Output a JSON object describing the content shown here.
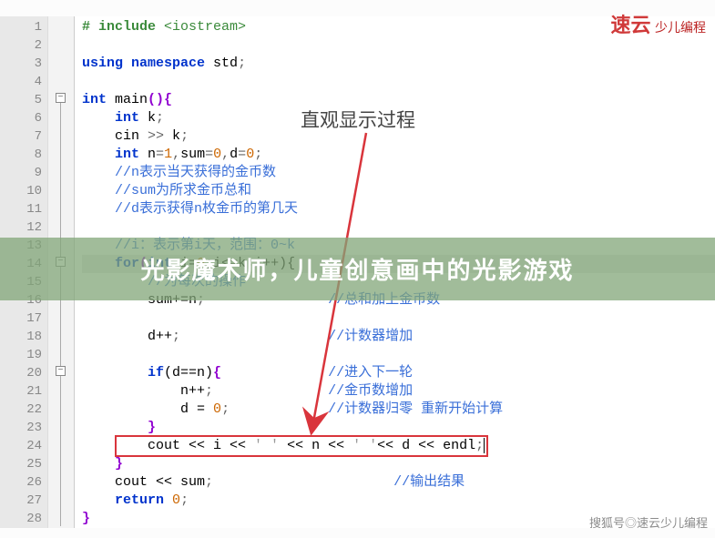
{
  "watermark_top_brand": "速云",
  "watermark_top_sub": "少儿编程",
  "watermark_bottom": "搜狐号◎速云少儿编程",
  "annotation": "直观显示过程",
  "banner": "光影魔术师，儿童创意画中的光影游戏",
  "lines": {
    "l1_pre": "# include ",
    "l1_inc": "<iostream>",
    "l3_using": "using",
    "l3_ns": "namespace",
    "l3_std": " std",
    "l3_semi": ";",
    "l5_int": "int",
    "l5_main": " main",
    "l5_par": "(){",
    "l6_int": "int",
    "l6_k": " k",
    "l6_semi": ";",
    "l7_cin": "cin ",
    "l7_op": ">>",
    "l7_k": " k",
    "l7_semi": ";",
    "l8_int": "int",
    "l8_n": " n",
    "l8_eq1": "=",
    "l8_1": "1",
    "l8_com1": ",",
    "l8_sum": "sum",
    "l8_eq2": "=",
    "l8_0a": "0",
    "l8_com2": ",",
    "l8_d": "d",
    "l8_eq3": "=",
    "l8_0b": "0",
    "l8_semi": ";",
    "l9": "//n表示当天获得的金币数",
    "l10": "//sum为所求金币总和",
    "l11": "//d表示获得n枚金币的第几天",
    "l13": "//i：表示第i天，范围：0~k",
    "l14_for": "for",
    "l14_par_o": "(",
    "l14_int": "int",
    "l14_ie0": " i=",
    "l14_0": "0",
    "l14_semi1": ";i<=k;i++){",
    "l15_c": "//为每次的操作",
    "l16_body": "sum+=n",
    "l16_semi": ";",
    "l16_c": "//总和加上金币数",
    "l18_body": "d++",
    "l18_semi": ";",
    "l18_c": "//计数器增加",
    "l20_if": "if",
    "l20_cond": "(d==n)",
    "l20_brace": "{",
    "l20_c": "//进入下一轮",
    "l21_body": "n++",
    "l21_semi": ";",
    "l21_c": "//金币数增加",
    "l22_body": "d = ",
    "l22_0": "0",
    "l22_semi": ";",
    "l22_c": "//计数器归零 重新开始计算",
    "l23_brace": "}",
    "l24": "cout << i << ",
    "l24_s1": "' '",
    "l24_m": " << n << ",
    "l24_s2": "' '",
    "l24_e": "<< d << endl",
    "l24_semi": ";",
    "l25_brace": "}",
    "l26_body": "cout << sum",
    "l26_semi": ";",
    "l26_c": "//输出结果",
    "l27_ret": "return",
    "l27_sp": " ",
    "l27_0": "0",
    "l27_semi": ";",
    "l28_brace": "}"
  }
}
